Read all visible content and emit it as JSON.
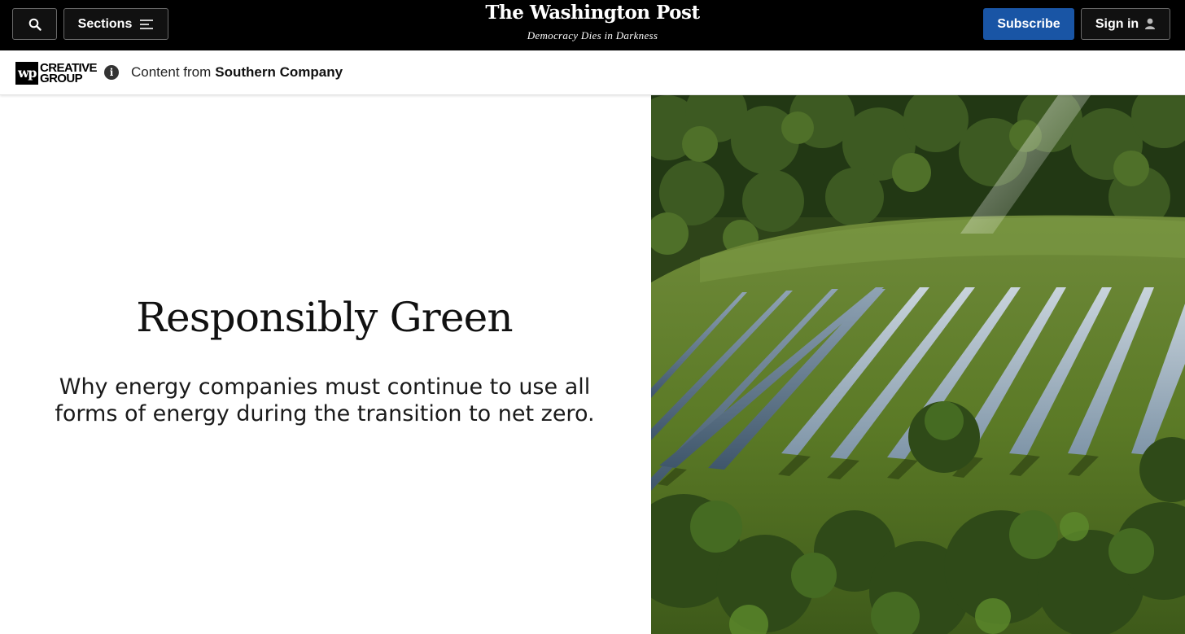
{
  "header": {
    "masthead": "The Washington Post",
    "tagline": "Democracy Dies in Darkness",
    "search_icon": "search-icon",
    "sections_label": "Sections",
    "sections_icon": "menu-icon",
    "subscribe_label": "Subscribe",
    "signin_label": "Sign in",
    "signin_icon": "user-icon"
  },
  "sponsor_bar": {
    "logo_mark": "wp",
    "logo_line1": "CREATIVE",
    "logo_line2": "GROUP",
    "info_icon": "info-icon",
    "content_prefix": "Content from",
    "sponsor_name": "Southern Company"
  },
  "hero": {
    "title": "Responsibly Green",
    "subtitle": "Why energy companies must continue to use all forms of energy during the transition to net zero.",
    "image_subject": "aerial-solar-farm-in-forest-clearing"
  },
  "colors": {
    "topbar_bg": "#000000",
    "subscribe_bg": "#1955a5",
    "button_border": "#6a6a6a"
  }
}
